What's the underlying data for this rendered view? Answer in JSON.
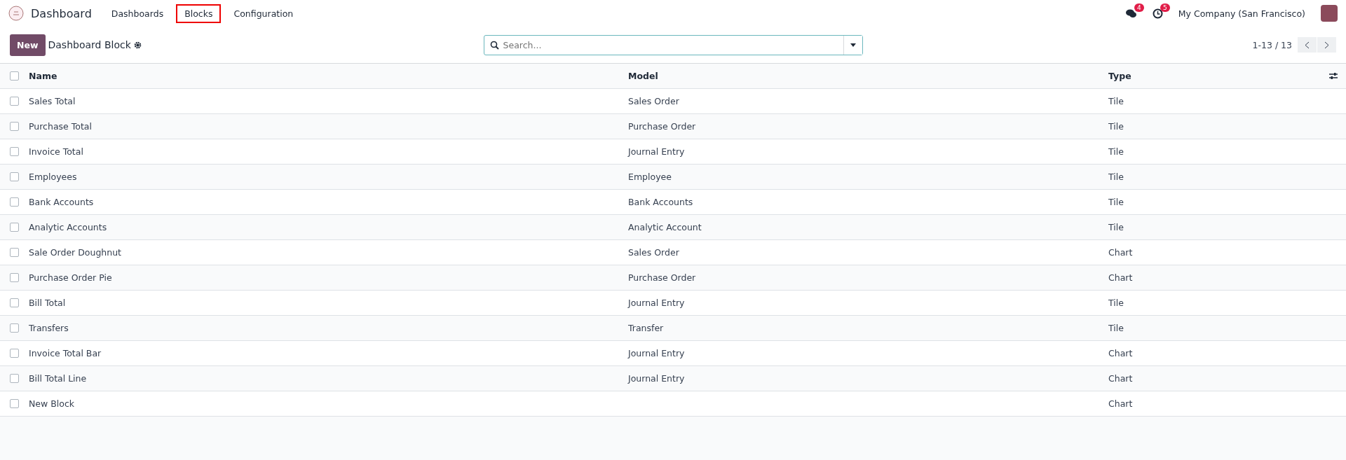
{
  "navbar": {
    "app_name": "Dashboard",
    "menu": [
      {
        "label": "Dashboards",
        "selected": false
      },
      {
        "label": "Blocks",
        "selected": true
      },
      {
        "label": "Configuration",
        "selected": false
      }
    ],
    "messages_count": "4",
    "activities_count": "5",
    "company": "My Company (San Francisco)"
  },
  "control_panel": {
    "new_button": "New",
    "title": "Dashboard Block",
    "search": {
      "placeholder": "Search..."
    },
    "pager": "1-13 / 13"
  },
  "table": {
    "select_all_checked": false,
    "columns": [
      "Name",
      "Model",
      "Type"
    ],
    "rows": [
      {
        "selected": false,
        "cells": [
          "Sales Total",
          "Sales Order",
          "Tile"
        ]
      },
      {
        "selected": false,
        "cells": [
          "Purchase Total",
          "Purchase Order",
          "Tile"
        ]
      },
      {
        "selected": false,
        "cells": [
          "Invoice Total",
          "Journal Entry",
          "Tile"
        ]
      },
      {
        "selected": false,
        "cells": [
          "Employees",
          "Employee",
          "Tile"
        ]
      },
      {
        "selected": false,
        "cells": [
          "Bank Accounts",
          "Bank Accounts",
          "Tile"
        ]
      },
      {
        "selected": false,
        "cells": [
          "Analytic Accounts",
          "Analytic Account",
          "Tile"
        ]
      },
      {
        "selected": false,
        "cells": [
          "Sale Order Doughnut",
          "Sales Order",
          "Chart"
        ]
      },
      {
        "selected": false,
        "cells": [
          "Purchase Order Pie",
          "Purchase Order",
          "Chart"
        ]
      },
      {
        "selected": false,
        "cells": [
          "Bill Total",
          "Journal Entry",
          "Tile"
        ]
      },
      {
        "selected": false,
        "cells": [
          "Transfers",
          "Transfer",
          "Tile"
        ]
      },
      {
        "selected": false,
        "cells": [
          "Invoice Total Bar",
          "Journal Entry",
          "Chart"
        ]
      },
      {
        "selected": false,
        "cells": [
          "Bill Total Line",
          "Journal Entry",
          "Chart"
        ]
      },
      {
        "selected": false,
        "cells": [
          "New Block",
          "",
          "Chart"
        ]
      }
    ]
  }
}
